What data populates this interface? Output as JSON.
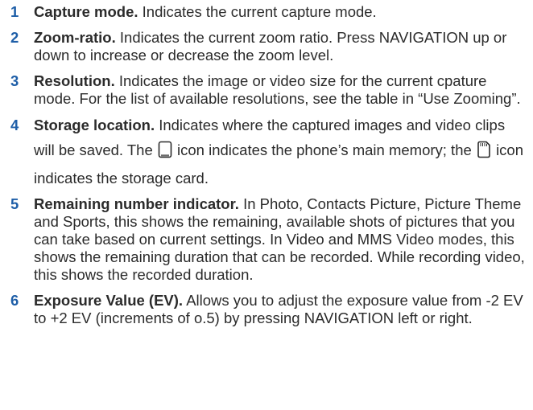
{
  "items": [
    {
      "number": "1",
      "term": "Capture mode.",
      "text": "Indicates the current capture mode."
    },
    {
      "number": "2",
      "term": "Zoom-ratio.",
      "text": "Indicates the current zoom ratio. Press NAVIGATION up or down to increase or decrease the zoom level."
    },
    {
      "number": "3",
      "term": "Resolution.",
      "text": "Indicates the image or video size for the current cpature mode. For the list of available resolutions, see the table in “Use Zooming”."
    },
    {
      "number": "4",
      "term": "Storage location.",
      "text_before_icon1": "Indicates where the captured images and video clips will be saved. The",
      "text_between_icons": "icon indicates the phone’s main memory; the",
      "text_after_icon2": "icon indicates the storage card.",
      "icon1": "phone-memory-icon",
      "icon2": "storage-card-icon"
    },
    {
      "number": "5",
      "term": "Remaining number indicator.",
      "text": "In Photo, Contacts Picture, Picture Theme and Sports, this shows the remaining, available shots of pictures that you can take based on current settings. In Video and MMS Video modes, this shows the remaining duration that can be recorded. While recording video, this shows the recorded duration."
    },
    {
      "number": "6",
      "term": "Exposure Value (EV).",
      "text": "Allows you to adjust the exposure value from -2 EV to +2 EV (increments of o.5) by pressing NAVIGATION left or right."
    }
  ]
}
